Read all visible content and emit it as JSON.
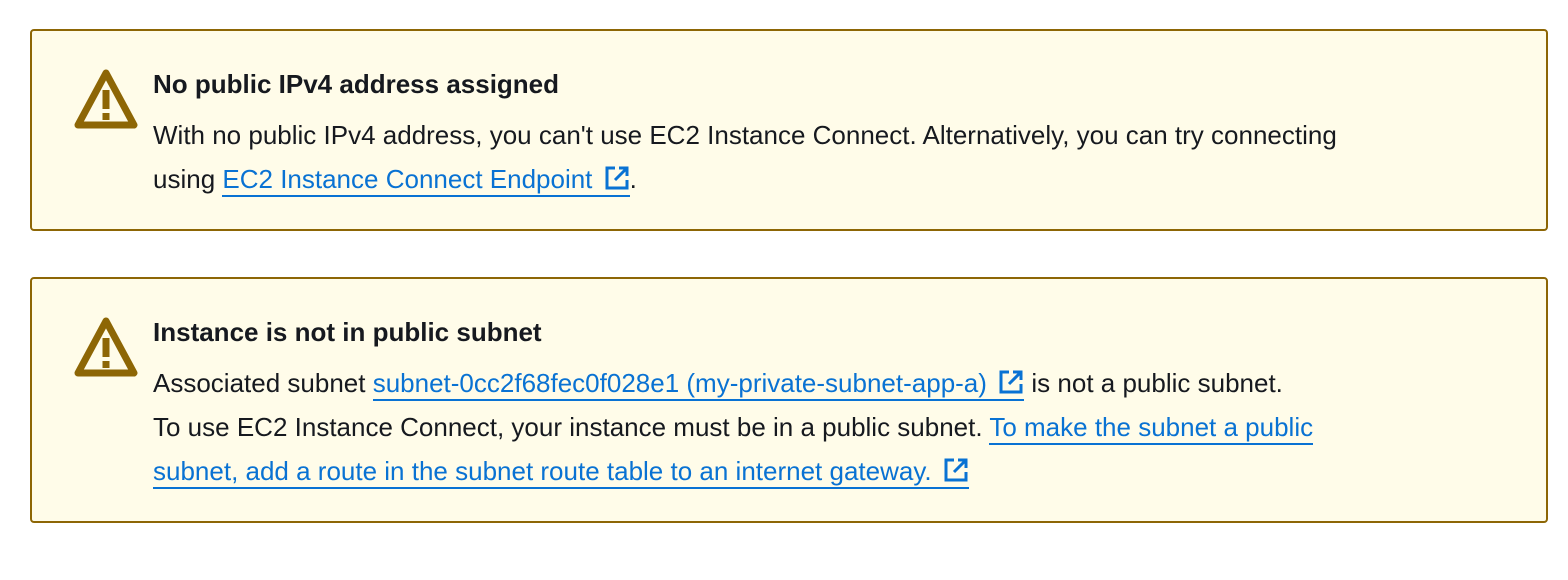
{
  "alerts": [
    {
      "icon": "warning-icon",
      "title": "No public IPv4 address assigned",
      "line1": "With no public IPv4 address, you can't use EC2 Instance Connect. Alternatively, you can try connecting",
      "line2_prefix": "using ",
      "link_text": "EC2 Instance Connect Endpoint",
      "line2_suffix": ".",
      "link_icon": "external-link-icon"
    },
    {
      "icon": "warning-icon",
      "title": "Instance is not in public subnet",
      "line1_prefix": "Associated subnet ",
      "subnet_link_text": "subnet-0cc2f68fec0f028e1 (my-private-subnet-app-a)",
      "line1_suffix": " is not a public subnet.",
      "line2_prefix": "To use EC2 Instance Connect, your instance must be in a public subnet. ",
      "route_link_part1": "To make the subnet a public",
      "route_link_part2": "subnet, add a route in the subnet route table to an internet gateway.",
      "link_icon": "external-link-icon"
    }
  ],
  "colors": {
    "alert_background": "#fffce9",
    "alert_border": "#8d6605",
    "warning_icon": "#8d6605",
    "link": "#0972d3",
    "text": "#16191f"
  }
}
